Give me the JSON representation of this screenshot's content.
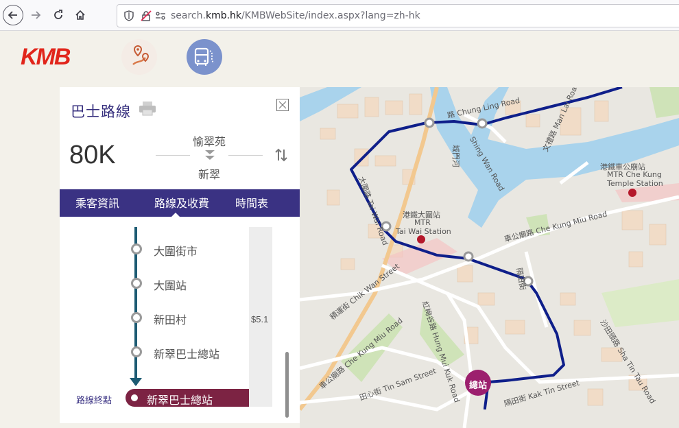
{
  "browser": {
    "url_prefix": "search.",
    "url_domain": "kmb.hk",
    "url_path": "/KMBWebSite/index.aspx?lang=zh-hk"
  },
  "site": {
    "logo_text": "KMB",
    "icons": [
      "route-planner-icon",
      "bus-route-icon"
    ]
  },
  "route_panel": {
    "title": "巴士路線",
    "route_number": "80K",
    "origin": "愉翠苑",
    "destination": "新翠",
    "tabs": [
      "乘客資訊",
      "路線及收費",
      "時間表"
    ],
    "active_tab": "路線及收費",
    "stops": [
      "大圍街市",
      "大圍站",
      "新田村",
      "新翠巴士總站"
    ],
    "terminal_label": "路線終點",
    "terminal_stop": "新翠巴士總站",
    "fare": "$5.1"
  },
  "map": {
    "terminus_badge": "總站",
    "labels": {
      "chung_ling_road": "路 Chung Ling Road",
      "shing_wan_road": "Shing Wan Road",
      "man_lai_road": "文禮路 Man Lai Road",
      "mtr_che_kung_zh": "港鐵車公廟站",
      "mtr_che_kung_en1": "MTR Che Kung",
      "mtr_che_kung_en2": "Temple Station",
      "mtr_tai_wai_zh": "港鐵大圍站",
      "mtr_tai_wai_en1": "MTR",
      "mtr_tai_wai_en2": "Tai Wai Station",
      "che_kung_miu_road_e": "車公廟路 Che Kung Miu Road",
      "chik_wan_street": "積運街 Chik Wan Street",
      "hung_mui_kuk_road": "紅梅谷路 Hung Mui Kuk Road",
      "che_kung_miu_road_w": "車公廟路 Che Kung Miu Road",
      "tin_sam_street": "田心街 Tin Sam Street",
      "kak_tin_street": "隔田街 Kak Tin Street",
      "sha_tin_tau_road": "沙田頭路 Sha Tin Tau Road",
      "tai_wai_road": "大圍路 Tai Wai Road",
      "shing_wan_road_zh": "城門河",
      "kak_tin_street_n": "隔田街"
    }
  },
  "colors": {
    "brand_purple": "#3a3283",
    "route_line": "#1d5b73",
    "terminal": "#7c2343",
    "map_route": "#0f1f8a",
    "kmb_red": "#e1251b"
  }
}
